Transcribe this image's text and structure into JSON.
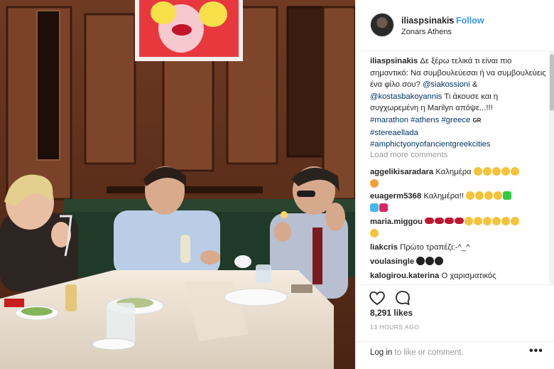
{
  "header": {
    "username": "iliaspsinakis",
    "separator": "•",
    "follow_label": "Follow",
    "location": "Zonars Athens"
  },
  "caption": {
    "username": "iliaspsinakis",
    "text1": "Δε ξέρω τελικά τι είναι πιο σημαντικό: Να συμβουλεύεσαι ή να συμβουλεύεις ένα φίλο σου?",
    "mention1": "@siakossioni",
    "amp": "&",
    "mention2": "@kostasbakoyannis",
    "text2": "Τι άκουσε και η συγχωρεμένη η Marilyn απόψε...!!!",
    "tags_line1": "#marathon #athens #greece",
    "flag": "GR",
    "tag2": "#stereaellada",
    "tag3": "#amphictyonyofancientgreekcities"
  },
  "load_more": "Load more comments",
  "comments": [
    {
      "user": "aggelikisaradara",
      "text": "Καλημέρα"
    },
    {
      "user": "euagerm5368",
      "text": "Καλημέρα!!"
    },
    {
      "user": "maria.miggou",
      "text": ""
    },
    {
      "user": "liakcris",
      "text": "Πρώτο τραπέζι:-^_^"
    },
    {
      "user": "voulasingle",
      "text": ""
    },
    {
      "user": "kalogirou.katerina",
      "text": "Ο χαρισματικός"
    }
  ],
  "actions": {
    "heart_icon": "heart-icon",
    "comment_icon": "comment-icon",
    "likes": "8,291 likes",
    "time": "13 HOURS AGO"
  },
  "footer": {
    "login_link": "Log in",
    "login_rest": "to like or comment.",
    "more_icon": "•••"
  },
  "colors": {
    "link": "#003569",
    "follow": "#3897f0",
    "muted": "#999999"
  }
}
